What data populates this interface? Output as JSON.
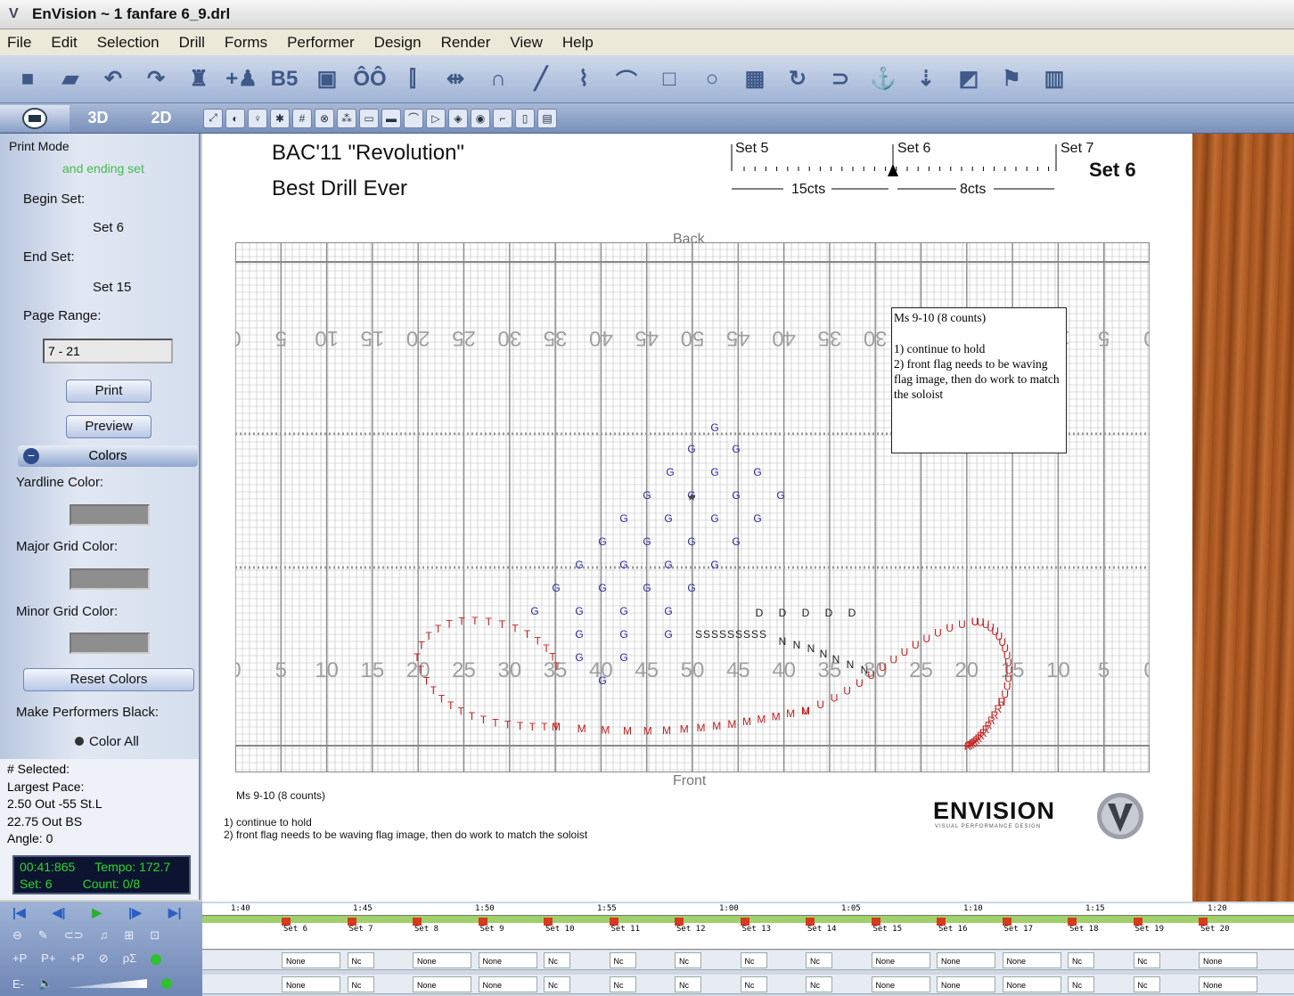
{
  "window": {
    "title": "EnVision ~ 1 fanfare 6_9.drl",
    "logo_icon": "envision-v-icon"
  },
  "menu": [
    "File",
    "Edit",
    "Selection",
    "Drill",
    "Forms",
    "Performer",
    "Design",
    "Render",
    "View",
    "Help"
  ],
  "toolbar": {
    "icons": [
      "stop-icon",
      "open-folder-icon",
      "undo-icon",
      "redo-icon",
      "performer-icon",
      "add-performer-icon",
      "badge-icon",
      "props-icon",
      "group-icon",
      "line-tools-icon",
      "align-icon",
      "headphone-icon",
      "line-icon",
      "curve-icon",
      "arc-icon",
      "rectangle-icon",
      "circle-icon",
      "block-icon",
      "follow-icon",
      "path-icon",
      "anchor-icon",
      "distribute-icon",
      "chart-icon",
      "flag-icon",
      "book-icon"
    ]
  },
  "mode_tabs": {
    "print": "print-mode-icon",
    "three_d": "3D",
    "two_d": "2D"
  },
  "left": {
    "print_mode": "Print Mode",
    "and_ending": "and ending set",
    "begin_set_label": "Begin Set:",
    "begin_set": "Set 6",
    "end_set_label": "End Set:",
    "end_set": "Set 15",
    "page_range_label": "Page Range:",
    "page_range": "7 - 21",
    "print_btn": "Print",
    "preview_btn": "Preview",
    "colors": "Colors",
    "yardline_color": "Yardline Color:",
    "major_grid": "Major Grid Color:",
    "minor_grid": "Minor Grid Color:",
    "reset_colors": "Reset Colors",
    "make_black": "Make Performers Black:",
    "color_all": "Color All",
    "swatch_color": "#8e8e8e"
  },
  "info": {
    "selected": "# Selected:",
    "largest_pace": "Largest Pace:",
    "pace1": "2.50 Out -55 St.L",
    "pace2": "22.75 Out BS",
    "angle": "Angle: 0",
    "time": "00:41:865",
    "tempo": "Tempo: 172.7",
    "set": "Set: 6",
    "count": "Count: 0/8"
  },
  "page": {
    "title": "BAC'11 \"Revolution\"",
    "subtitle": "Best Drill Ever",
    "set5": "Set 5",
    "set6": "Set 6",
    "set7": "Set 7",
    "current_set": "Set 6",
    "cts1": "15cts",
    "cts2": "8cts",
    "back": "Back",
    "front": "Front",
    "note_title": "Ms 9-10 (8 counts)",
    "note_1": "1) continue to hold",
    "note_2": "2) front flag needs to be waving flag image, then do work to match the soloist",
    "box_title": "Ms 9-10 (8 counts)",
    "box_1": "1) continue to hold",
    "box_2": "2) front flag needs to be waving flag image, then do work to match the soloist",
    "brand": "ENVISION",
    "brand_sub": "VISUAL PERFORMANCE DESIGN",
    "yard_numbers": [
      "0",
      "5",
      "10",
      "15",
      "20",
      "25",
      "30",
      "35",
      "40",
      "45",
      "50",
      "45",
      "40",
      "35",
      "30",
      "25",
      "20",
      "15",
      "10",
      "5",
      "0"
    ],
    "field_green": "#ffffff"
  },
  "timeline": {
    "time_marks": [
      "1:40",
      "1:45",
      "1:50",
      "1:55",
      "1:00",
      "1:05",
      "1:10",
      "1:15",
      "1:20"
    ],
    "sets": [
      "Set 6",
      "Set 7",
      "Set 8",
      "Set 9",
      "Set 10",
      "Set 11",
      "Set 12",
      "Set 13",
      "Set 14",
      "Set 15",
      "Set 16",
      "Set 17",
      "Set 18",
      "Set 19",
      "Set 20"
    ],
    "none_label": "None",
    "nc_label": "Nc"
  }
}
